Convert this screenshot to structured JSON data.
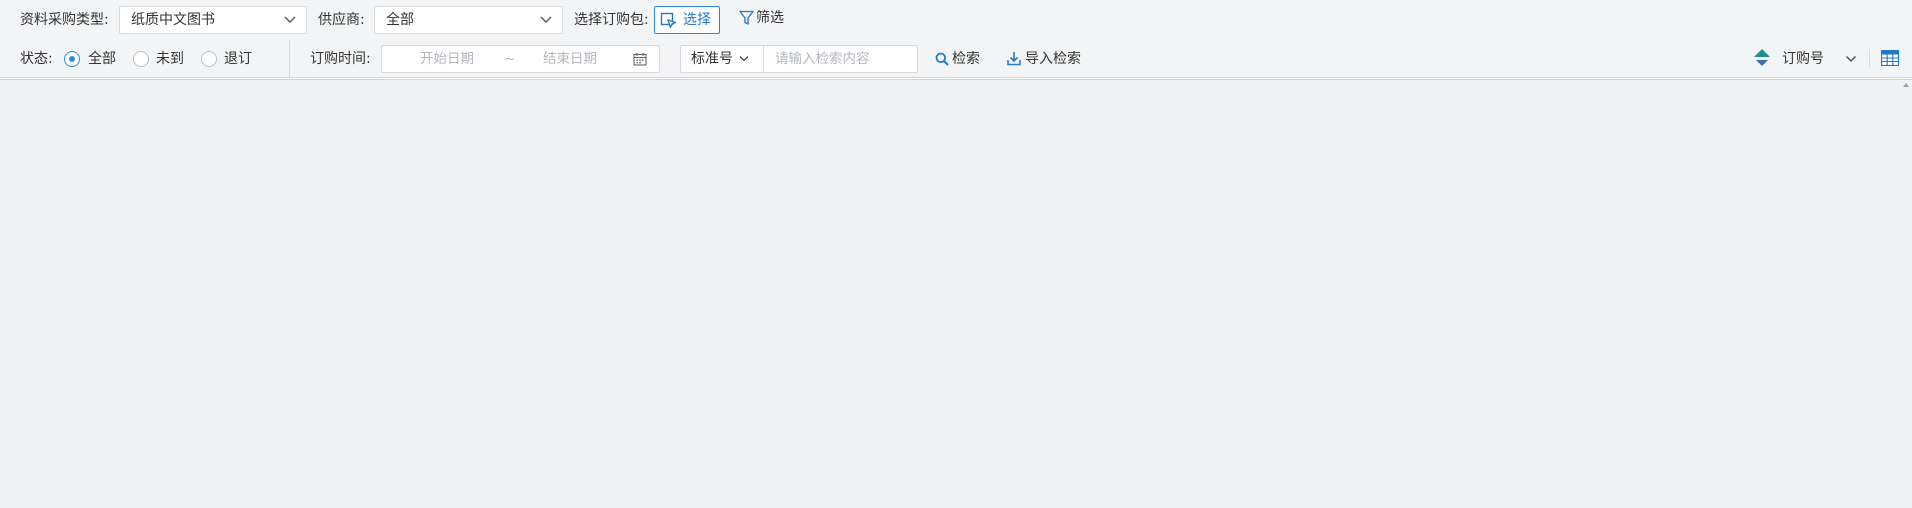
{
  "row1": {
    "type_label": "资料采购类型:",
    "type_value": "纸质中文图书",
    "supplier_label": "供应商:",
    "supplier_value": "全部",
    "package_label": "选择订购包:",
    "pick_button": "选择",
    "filter_button": "筛选"
  },
  "row2": {
    "status_label": "状态:",
    "status_options": [
      "全部",
      "未到",
      "退订"
    ],
    "status_selected": "全部",
    "order_time_label": "订购时间:",
    "start_date_placeholder": "开始日期",
    "range_sep": "~",
    "end_date_placeholder": "结束日期",
    "search_field": "标准号",
    "search_placeholder": "请输入检索内容",
    "search_button": "检索",
    "import_search_button": "导入检索",
    "sort_field": "订购号"
  },
  "colors": {
    "accent": "#2c8bd8",
    "toolbar_bg": "#f3f4f6",
    "content_bg": "#eff1f4",
    "sort_icon": "#1f8f8f"
  },
  "icons": [
    "chevron-down-icon",
    "cursor-select-icon",
    "filter-icon",
    "calendar-icon",
    "search-icon",
    "download-icon",
    "sort-icon",
    "table-grid-icon"
  ]
}
